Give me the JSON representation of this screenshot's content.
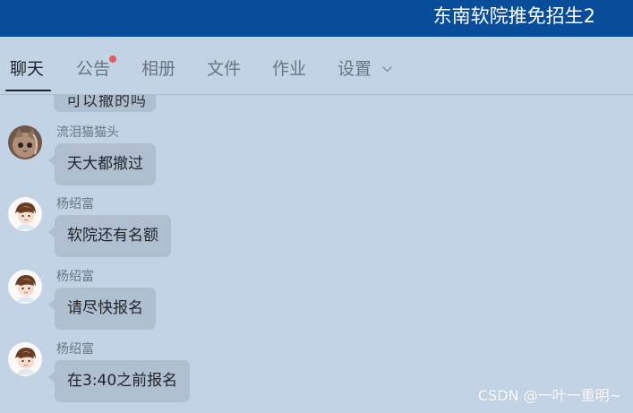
{
  "window": {
    "title": "东南软院推免招生2"
  },
  "tabs": [
    {
      "label": "聊天",
      "active": true
    },
    {
      "label": "公告",
      "unread_dot": true
    },
    {
      "label": "相册"
    },
    {
      "label": "文件"
    },
    {
      "label": "作业"
    },
    {
      "label": "设置",
      "has_dropdown": true
    }
  ],
  "messages": [
    {
      "sender": "流泪猫猫头",
      "text": "天大都撤过",
      "avatar_icon": "cat-photo-avatar-icon"
    },
    {
      "sender": "杨绍富",
      "text": "软院还有名额",
      "avatar_icon": "cartoon-person-avatar-icon"
    },
    {
      "sender": "杨绍富",
      "text": "请尽快报名",
      "avatar_icon": "cartoon-person-avatar-icon"
    },
    {
      "sender": "杨绍富",
      "text": "在3:40之前报名",
      "avatar_icon": "cartoon-person-avatar-icon"
    }
  ],
  "partial_message": {
    "text": "可以撤的吗"
  },
  "watermark": "CSDN @一叶一重明~",
  "colors": {
    "title_bar": "#074d99",
    "background": "#c2d3e6",
    "bubble": "#afbfd0",
    "unread_badge": "#e35a5a",
    "active_tab": "#1f2329",
    "inactive_tab": "#6a7583"
  }
}
